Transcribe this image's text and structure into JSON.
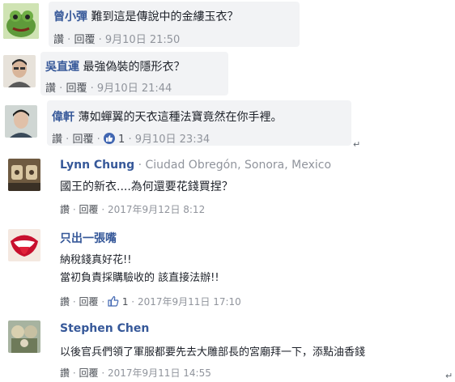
{
  "comments": [
    {
      "author": "曾小彈",
      "text": "難到這是傳說中的金縷玉衣？",
      "actions": {
        "like": "讚",
        "reply": "回覆",
        "time": "9月10日 21:50"
      }
    },
    {
      "author": "吳直運",
      "text": "最強偽裝的隱形衣？",
      "actions": {
        "like": "讚",
        "reply": "回覆",
        "time": "9月10日 21:44"
      }
    },
    {
      "author": "偉軒",
      "text": "薄如蟬翼的天衣這種法寶竟然在你手裡。",
      "actions": {
        "like": "讚",
        "reply": "回覆",
        "reaction_count": "1",
        "time": "9月10日 23:34"
      }
    },
    {
      "author": "Lynn Chung",
      "location": "Ciudad Obregón, Sonora, Mexico",
      "text": "國王的新衣....為何還要花錢買捏？",
      "actions": {
        "like": "讚",
        "reply": "回覆",
        "time": "2017年9月12日 8:12"
      }
    },
    {
      "author": "只出一張嘴",
      "lines": [
        "納稅錢真好花!!",
        "當初負責採購驗收的 該直接法辦!!"
      ],
      "actions": {
        "like": "讚",
        "reply": "回覆",
        "reaction_count": "1",
        "time": "2017年9月11日 17:10"
      }
    },
    {
      "author": "Stephen Chen",
      "text": "以後官兵們領了軍服都要先去大雕部長的宮廟拜一下，添點油香錢",
      "actions": {
        "like": "讚",
        "reply": "回覆",
        "time": "2017年9月11日 14:55"
      }
    }
  ],
  "separator": "·",
  "colors": {
    "link": "#365899",
    "meta": "#90949c",
    "bubble": "#f2f3f5",
    "like_blue": "#4267b2"
  }
}
